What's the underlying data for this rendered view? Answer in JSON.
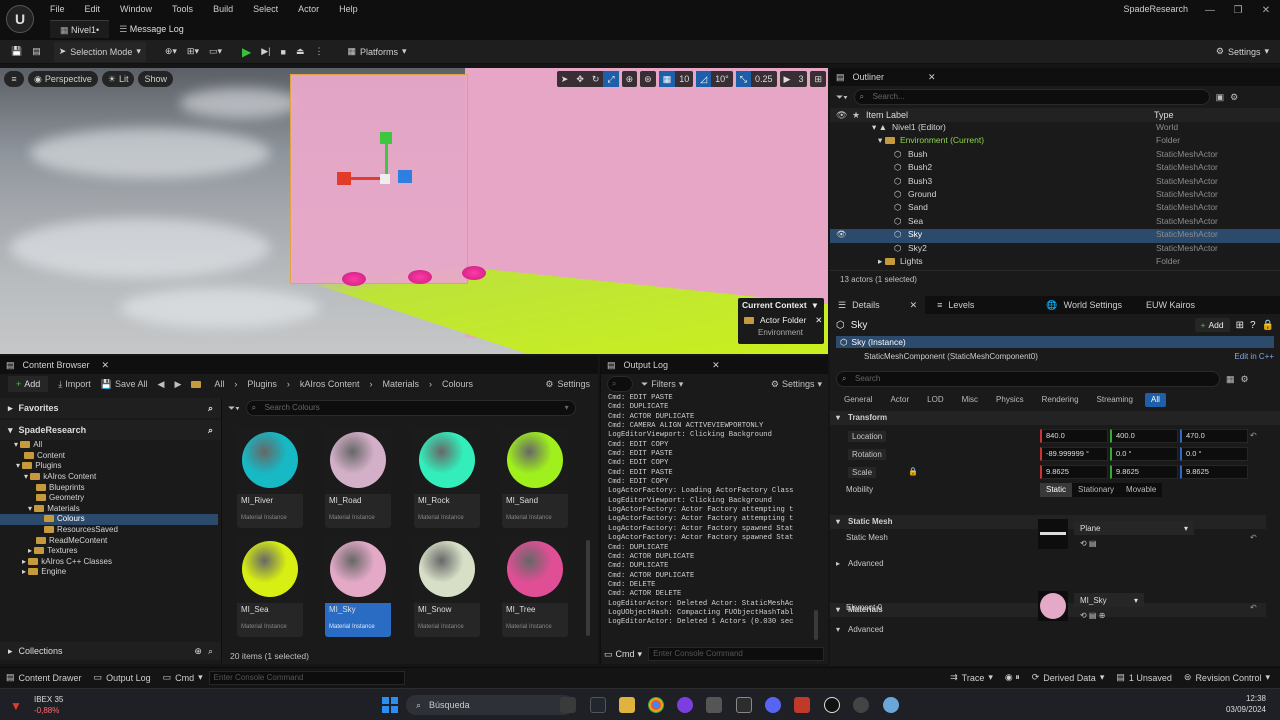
{
  "app": {
    "menu": [
      "File",
      "Edit",
      "Window",
      "Tools",
      "Build",
      "Select",
      "Actor",
      "Help"
    ],
    "tabs": [
      {
        "label": "Nivel1•"
      },
      {
        "label": "Message Log"
      }
    ],
    "project": "SpadeResearch"
  },
  "toolbar": {
    "selection_mode": "Selection Mode",
    "platforms": "Platforms",
    "settings": "Settings"
  },
  "viewport": {
    "perspective": "Perspective",
    "lit": "Lit",
    "show": "Show",
    "grid_snap": "10",
    "rot_snap": "10°",
    "scale_snap": "0.25",
    "cam_speed": "3",
    "context": {
      "title": "Current Context",
      "folder": "Actor Folder",
      "path": "Environment"
    }
  },
  "outliner": {
    "title": "Outliner",
    "search_placeholder": "Search...",
    "col_label": "Item Label",
    "col_type": "Type",
    "items": [
      {
        "label": "Nivel1 (Editor)",
        "type": "World"
      },
      {
        "label": "Environment (Current)",
        "type": "Folder"
      },
      {
        "label": "Bush",
        "type": "StaticMeshActor"
      },
      {
        "label": "Bush2",
        "type": "StaticMeshActor"
      },
      {
        "label": "Bush3",
        "type": "StaticMeshActor"
      },
      {
        "label": "Ground",
        "type": "StaticMeshActor"
      },
      {
        "label": "Sand",
        "type": "StaticMeshActor"
      },
      {
        "label": "Sea",
        "type": "StaticMeshActor"
      },
      {
        "label": "Sky",
        "type": "StaticMeshActor"
      },
      {
        "label": "Sky2",
        "type": "StaticMeshActor"
      },
      {
        "label": "Lights",
        "type": "Folder"
      }
    ],
    "footer": "13 actors (1 selected)"
  },
  "details": {
    "tabs": [
      "Details",
      "Levels",
      "World Settings",
      "EUW Kairos"
    ],
    "actor": "Sky",
    "add": "Add",
    "instance": "Sky (Instance)",
    "component": "StaticMeshComponent (StaticMeshComponent0)",
    "edit_cpp": "Edit in C++",
    "search_placeholder": "Search",
    "filters": [
      "General",
      "Actor",
      "LOD",
      "Misc",
      "Physics",
      "Rendering",
      "Streaming",
      "All"
    ],
    "transform_label": "Transform",
    "location": {
      "label": "Location",
      "x": "840.0",
      "y": "400.0",
      "z": "470.0"
    },
    "rotation": {
      "label": "Rotation",
      "x": "-89.999999 °",
      "y": "0.0 °",
      "z": "0.0 °"
    },
    "scale": {
      "label": "Scale",
      "x": "9.8625",
      "y": "9.8625",
      "z": "9.8625"
    },
    "mobility": {
      "label": "Mobility",
      "options": [
        "Static",
        "Stationary",
        "Movable"
      ]
    },
    "static_mesh_cat": "Static Mesh",
    "static_mesh_label": "Static Mesh",
    "static_mesh_value": "Plane",
    "advanced": "Advanced",
    "materials_cat": "Materials",
    "element0": "Element 0",
    "element0_value": "MI_Sky"
  },
  "content_browser": {
    "title": "Content Browser",
    "add": "Add",
    "import": "Import",
    "save_all": "Save All",
    "settings": "Settings",
    "path": [
      "All",
      "Plugins",
      "kAIros Content",
      "Materials",
      "Colours"
    ],
    "favorites": "Favorites",
    "root": "SpadeResearch",
    "tree": [
      "All",
      "Content",
      "Plugins",
      "kAIros Content",
      "Blueprints",
      "Geometry",
      "Materials",
      "Colours",
      "ResourcesSaved",
      "ReadMeContent",
      "Textures",
      "kAIros C++ Classes",
      "Engine"
    ],
    "search_placeholder": "Search Colours",
    "tiles": [
      {
        "name": "MI_River",
        "type": "Material Instance",
        "color": "#16b9c4"
      },
      {
        "name": "MI_Road",
        "type": "Material Instance",
        "color": "#d4b0c8"
      },
      {
        "name": "MI_Rock",
        "type": "Material Instance",
        "color": "#33eebb"
      },
      {
        "name": "MI_Sand",
        "type": "Material Instance",
        "color": "#9ff01c"
      },
      {
        "name": "MI_Sea",
        "type": "Material Instance",
        "color": "#d7ef12"
      },
      {
        "name": "MI_Sky",
        "type": "Material Instance",
        "color": "#e3a9c6"
      },
      {
        "name": "MI_Snow",
        "type": "Material Instance",
        "color": "#d7e0c7"
      },
      {
        "name": "MI_Tree",
        "type": "Material Instance",
        "color": "#e04f95"
      }
    ],
    "collections": "Collections",
    "footer": "20 items (1 selected)"
  },
  "output_log": {
    "title": "Output Log",
    "filters": "Filters",
    "settings": "Settings",
    "cmd": "Cmd",
    "console_placeholder": "Enter Console Command",
    "lines": [
      "Cmd: EDIT PASTE",
      "Cmd: DUPLICATE",
      "Cmd: ACTOR DUPLICATE",
      "Cmd: CAMERA ALIGN ACTIVEVIEWPORTONLY",
      "LogEditorViewport: Clicking Background",
      "Cmd: EDIT COPY",
      "Cmd: EDIT PASTE",
      "Cmd: EDIT COPY",
      "Cmd: EDIT PASTE",
      "Cmd: EDIT COPY",
      "LogActorFactory: Loading ActorFactory Class",
      "LogEditorViewport: Clicking Background",
      "LogActorFactory: Actor Factory attempting t",
      "LogActorFactory: Actor Factory attempting t",
      "LogActorFactory: Actor Factory spawned Stat",
      "LogActorFactory: Actor Factory spawned Stat",
      "Cmd: DUPLICATE",
      "Cmd: ACTOR DUPLICATE",
      "Cmd: DUPLICATE",
      "Cmd: ACTOR DUPLICATE",
      "Cmd: DELETE",
      "Cmd: ACTOR DELETE",
      "LogEditorActor: Deleted Actor: StaticMeshAc",
      "LogUObjectHash: Compacting FUObjectHashTabl",
      "LogEditorActor: Deleted 1 Actors (0.030 sec"
    ]
  },
  "statusbar": {
    "content_drawer": "Content Drawer",
    "output_log": "Output Log",
    "cmd": "Cmd",
    "console_placeholder": "Enter Console Command",
    "trace": "Trace",
    "derived_data": "Derived Data",
    "unsaved": "1 Unsaved",
    "revision": "Revision Control"
  },
  "taskbar": {
    "stock_name": "IBEX 35",
    "stock_change": "-0,88%",
    "search": "Búsqueda",
    "time": "12:38",
    "date": "03/09/2024"
  }
}
